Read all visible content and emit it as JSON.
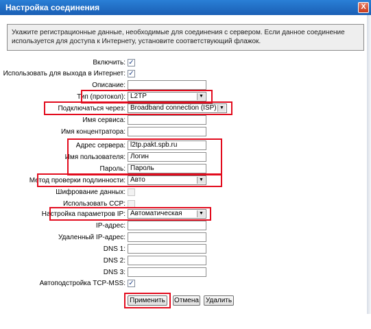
{
  "window": {
    "title": "Настройка соединения",
    "close_label": "X"
  },
  "info_text": "Укажите регистрационные данные, необходимые для соединения с сервером. Если данное соединение используется для доступа к Интернету, установите соответствующий флажок.",
  "form": {
    "enable": {
      "label": "Включить:",
      "checked": true
    },
    "use_for_internet": {
      "label": "Использовать для выхода в Интернет:",
      "checked": true
    },
    "description": {
      "label": "Описание:",
      "value": ""
    },
    "protocol_type": {
      "label": "Тип (протокол):",
      "value": "L2TP"
    },
    "connect_via": {
      "label": "Подключаться через:",
      "value": "Broadband connection (ISP)"
    },
    "service_name": {
      "label": "Имя сервиса:",
      "value": ""
    },
    "concentrator_name": {
      "label": "Имя концентратора:",
      "value": ""
    },
    "server_address": {
      "label": "Адрес сервера:",
      "value": "l2tp.pakt.spb.ru"
    },
    "username": {
      "label": "Имя пользователя:",
      "value": "Логин"
    },
    "password": {
      "label": "Пароль:",
      "value": "Пароль"
    },
    "auth_method": {
      "label": "Метод проверки подлинности:",
      "value": "Авто"
    },
    "data_encryption": {
      "label": "Шифрование данных:",
      "checked": false
    },
    "use_ccp": {
      "label": "Использовать CCP:",
      "checked": false
    },
    "ip_settings": {
      "label": "Настройка параметров IP:",
      "value": "Автоматическая"
    },
    "ip_address": {
      "label": "IP-адрес:",
      "value": ""
    },
    "remote_ip": {
      "label": "Удаленный IP-адрес:",
      "value": ""
    },
    "dns1": {
      "label": "DNS 1:",
      "value": ""
    },
    "dns2": {
      "label": "DNS 2:",
      "value": ""
    },
    "dns3": {
      "label": "DNS 3:",
      "value": ""
    },
    "tcp_mss": {
      "label": "Автоподстройка TCP-MSS:",
      "checked": true
    }
  },
  "buttons": {
    "apply": "Применить",
    "cancel": "Отмена",
    "delete": "Удалить"
  },
  "icons": {
    "checkmark": "✓",
    "dropdown_arrow": "▼"
  },
  "colors": {
    "highlight": "#e20b1d",
    "titlebar": "#1f6cc8"
  }
}
